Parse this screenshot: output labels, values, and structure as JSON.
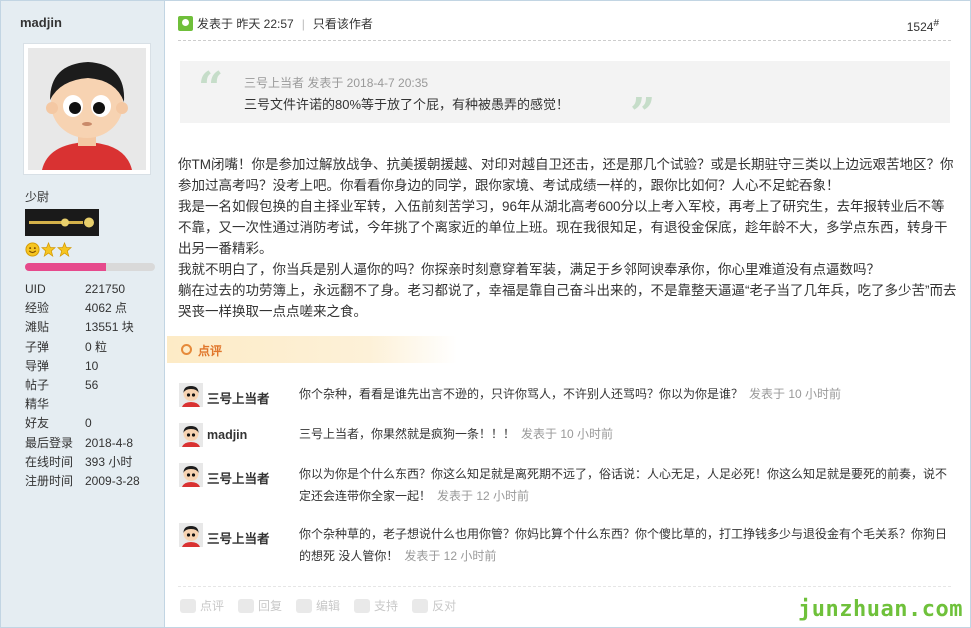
{
  "user": {
    "name": "madjin",
    "rank": "少尉",
    "progress_fraction": 0.62,
    "stats": [
      {
        "key": "UID",
        "value": "221750"
      },
      {
        "key": "经验",
        "value": "4062 点"
      },
      {
        "key": "滩贴",
        "value": "13551 块"
      },
      {
        "key": "子弹",
        "value": "0 粒"
      },
      {
        "key": "导弹",
        "value": "10"
      },
      {
        "key": "帖子",
        "value": "56"
      },
      {
        "key": "精华",
        "value": ""
      },
      {
        "key": "好友",
        "value": "0"
      },
      {
        "key": "最后登录",
        "value": "2018-4-8"
      },
      {
        "key": "在线时间",
        "value": "393 小时"
      },
      {
        "key": "注册时间",
        "value": "2009-3-28"
      }
    ]
  },
  "post": {
    "posted_label": "发表于 昨天 22:57",
    "only_author": "只看该作者",
    "floor": "1524",
    "floor_sup": "#",
    "quote": {
      "meta": "三号上当者 发表于 2018-4-7 20:35",
      "text": "三号文件许诺的80%等于放了个屁，有种被愚弄的感觉！"
    },
    "paragraphs": [
      "你TM闭嘴！你是参加过解放战争、抗美援朝援越、对印对越自卫还击，还是那几个试验？或是长期驻守三类以上边远艰苦地区？你参加过高考吗？没考上吧。你看看你身边的同学，跟你家境、考试成绩一样的，跟你比如何？人心不足蛇吞象！",
      "我是一名如假包换的自主择业军转，入伍前刻苦学习，96年从湖北高考600分以上考入军校，再考上了研究生，去年报转业后不等不靠，又一次性通过消防考试，今年挑了个离家近的单位上班。现在我很知足，有退役金保底，趁年龄不大，多学点东西，转身干出另一番精彩。",
      "我就不明白了，你当兵是别人逼你的吗？你探亲时刻意穿着军装，满足于乡邻阿谀奉承你，你心里难道没有点逼数吗？",
      "躺在过去的功劳簿上，永远翻不了身。老习都说了，幸福是靠自己奋斗出来的，不是靠整天逼逼“老子当了几年兵，吃了多少苦”而去哭丧一样换取一点点嗟来之食。"
    ]
  },
  "comments": {
    "label": "点评",
    "items": [
      {
        "name": "三号上当者",
        "text": "你个杂种，看看是谁先出言不逊的，只许你骂人，不许别人还骂吗？你以为你是谁？",
        "time": "发表于 10 小时前"
      },
      {
        "name": "madjin",
        "text": "三号上当者，你果然就是疯狗一条！！！",
        "time": "发表于 10 小时前"
      },
      {
        "name": "三号上当者",
        "text": "你以为你是个什么东西？你这么知足就是离死期不远了，俗话说：人心无足，人足必死！你这么知足就是要死的前奏，说不定还会连带你全家一起！",
        "time": "发表于 12 小时前"
      },
      {
        "name": "三号上当者",
        "text": "你个杂种草的，老子想说什么也用你管？你妈比算个什么东西？你个傻比草的，打工挣钱多少与退役金有个毛关系？你狗日的想死 没人管你！",
        "time": "发表于 12 小时前"
      }
    ]
  },
  "actions": [
    "点评",
    "回复",
    "编辑",
    "支持",
    "反对"
  ],
  "watermark": "junzhuan.com",
  "colors": {
    "accent_green": "#6fc13b",
    "comment_orange": "#e0762b",
    "sidebar_bg": "#e5edf2",
    "progress_pink": "#e64a8c"
  }
}
